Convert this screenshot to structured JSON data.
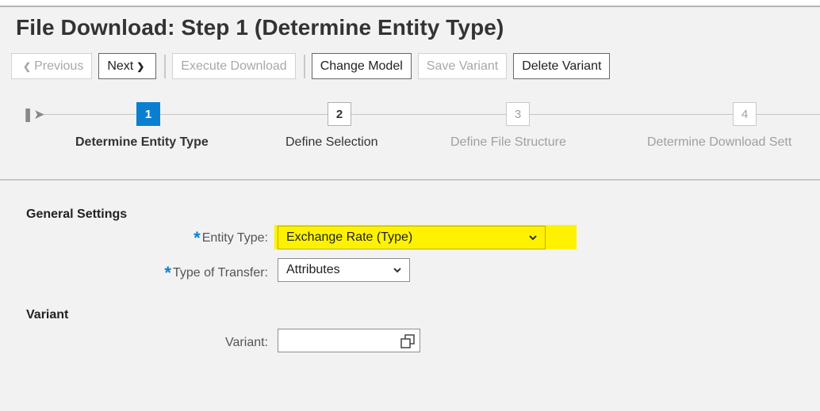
{
  "title": "File Download: Step 1  (Determine Entity Type)",
  "toolbar": {
    "previous": "Previous",
    "next": "Next",
    "execute_download": "Execute Download",
    "change_model": "Change Model",
    "save_variant": "Save Variant",
    "delete_variant": "Delete Variant"
  },
  "roadmap": {
    "steps": [
      {
        "number": "1",
        "label": "Determine Entity Type",
        "state": "active"
      },
      {
        "number": "2",
        "label": "Define Selection",
        "state": "enabled"
      },
      {
        "number": "3",
        "label": "Define File Structure",
        "state": "disabled"
      },
      {
        "number": "4",
        "label": "Determine Download Sett",
        "state": "disabled"
      }
    ]
  },
  "general_settings": {
    "heading": "General Settings",
    "entity_type_label": "Entity Type:",
    "entity_type_value": "Exchange Rate (Type)",
    "transfer_label": "Type of Transfer:",
    "transfer_value": "Attributes"
  },
  "variant": {
    "heading": "Variant",
    "label": "Variant:",
    "value": ""
  },
  "required_marker": "*",
  "colors": {
    "accent": "#0a7fd1",
    "highlight": "#fff200"
  }
}
